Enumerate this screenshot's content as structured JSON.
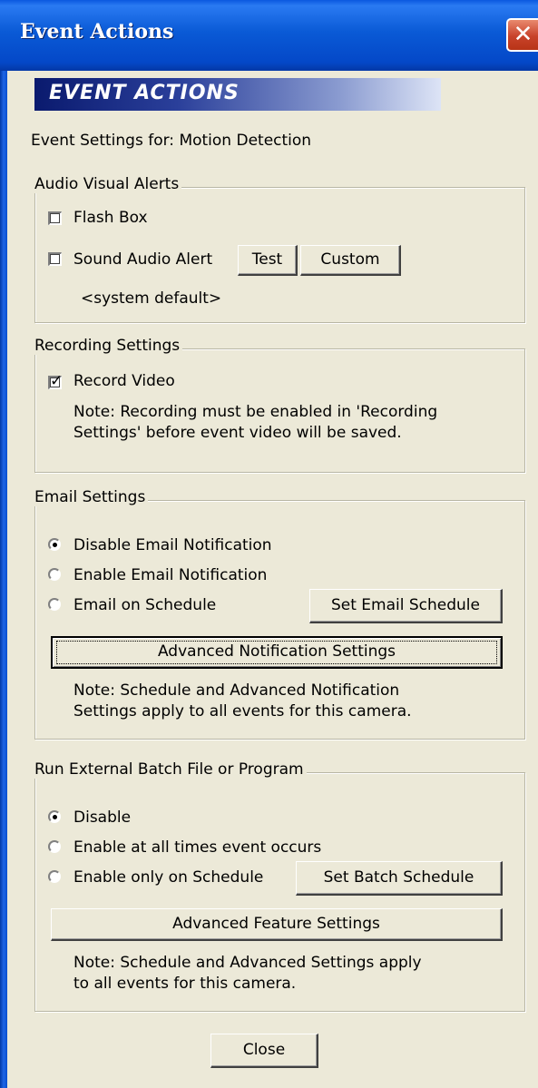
{
  "window": {
    "title": "Event Actions",
    "close_glyph": "✕"
  },
  "banner": {
    "text": "EVENT ACTIONS"
  },
  "event_settings_label": "Event Settings for: Motion Detection",
  "audio_visual": {
    "legend": "Audio Visual Alerts",
    "flash_box": {
      "label": "Flash Box",
      "checked": false
    },
    "sound_alert": {
      "label": "Sound Audio Alert",
      "checked": false
    },
    "test_button": "Test",
    "custom_button": "Custom",
    "sound_value": "<system default>"
  },
  "recording": {
    "legend": "Recording Settings",
    "record_video": {
      "label": "Record Video",
      "checked": true,
      "check_glyph": "✓"
    },
    "note_line1": "Note: Recording must be enabled in 'Recording",
    "note_line2": "Settings' before event video will be saved."
  },
  "email": {
    "legend": "Email Settings",
    "options": [
      "Disable Email Notification",
      "Enable Email Notification",
      "Email on Schedule"
    ],
    "selected": 0,
    "schedule_button": "Set Email Schedule",
    "advanced_button": "Advanced Notification Settings",
    "note_line1": "Note: Schedule and Advanced Notification",
    "note_line2": "Settings apply to all events for this camera."
  },
  "batch": {
    "legend": "Run External Batch File or Program",
    "options": [
      "Disable",
      "Enable at all times event occurs",
      "Enable only on Schedule"
    ],
    "selected": 0,
    "schedule_button": "Set Batch Schedule",
    "advanced_button": "Advanced Feature Settings",
    "note_line1": "Note: Schedule and Advanced Settings apply",
    "note_line2": "to all events for this camera."
  },
  "close_button": "Close"
}
